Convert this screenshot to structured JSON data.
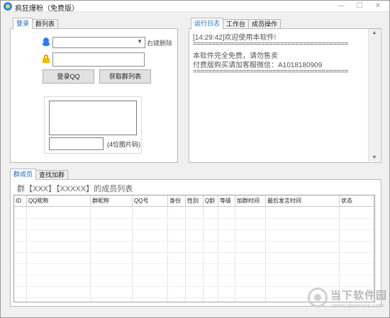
{
  "window": {
    "title": "疯狂爆粉（免费版）",
    "controls": {
      "minimize": "—",
      "maximize": "☐",
      "close": "✕"
    }
  },
  "left_panel": {
    "tabs": [
      {
        "label": "登录",
        "active": true
      },
      {
        "label": "群列表",
        "active": false
      }
    ],
    "qq_combo": {
      "value": "",
      "hint": "右键删除"
    },
    "password": {
      "value": ""
    },
    "buttons": {
      "login": "登录QQ",
      "get_groups": "获取群列表"
    },
    "captcha": {
      "value": "",
      "hint": "(4位图片码)"
    }
  },
  "right_panel": {
    "tabs": [
      {
        "label": "运行日志",
        "active": true
      },
      {
        "label": "工作台",
        "active": false
      },
      {
        "label": "成员操作",
        "active": false
      }
    ],
    "log_lines": [
      "[14:29:42]欢迎使用本软件!",
      "=========================================",
      "本软件完全免费，请勿售卖",
      "付费版购买请加客服微信：A1018180909",
      "========================================="
    ]
  },
  "bottom_panel": {
    "tabs": [
      {
        "label": "群成员",
        "active": true
      },
      {
        "label": "查找加群",
        "active": false
      }
    ],
    "list_title": "群【XXX】【XXXXX】的成员列表",
    "columns": [
      "ID",
      "QQ昵称",
      "群昵称",
      "QQ号",
      "身份",
      "性别",
      "Q龄",
      "等级",
      "加群时间",
      "最后发言时间",
      "状态"
    ],
    "rows": []
  },
  "watermark": {
    "text": "当下软件园",
    "url": "www.downxia.com"
  },
  "colors": {
    "accent": "#1565c0",
    "window_bg": "#f0f0f0",
    "panel_bg": "#ffffff",
    "border": "#b9b9b9"
  },
  "icons": [
    "app-icon",
    "qq-penguin-icon",
    "lock-icon",
    "chevron-down-icon",
    "scroll-up-icon",
    "scroll-down-icon",
    "watermark-logo-icon"
  ]
}
